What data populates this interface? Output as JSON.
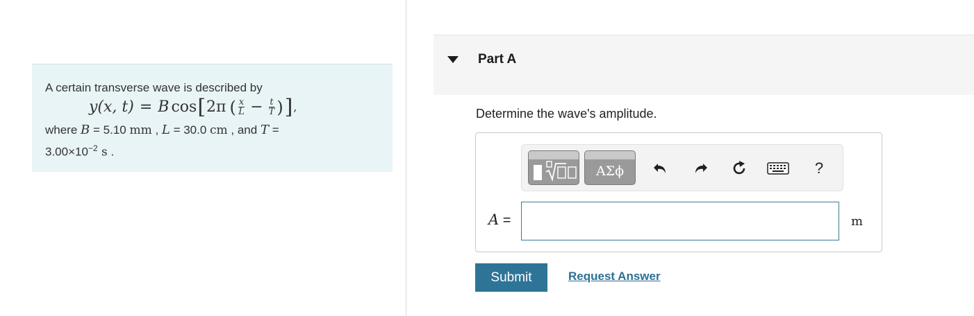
{
  "problem": {
    "intro": "A certain transverse wave is described by",
    "equation": {
      "lhs": "y(x, t)",
      "equals": "=",
      "amp": "B",
      "func": "cos",
      "two_pi": "2π",
      "frac1_num": "x",
      "frac1_den": "L",
      "minus": "−",
      "frac2_num": "t",
      "frac2_den": "T",
      "trail": ","
    },
    "where": "where",
    "B_var": "B",
    "B_eq": " = 5.10 ",
    "B_unit": "mm",
    "sep1": " , ",
    "L_var": "L",
    "L_eq": " = 30.0 ",
    "L_unit": "cm",
    "sep2": " , and ",
    "T_var": "T",
    "T_eq": " =",
    "T_mantissa": "3.00×10",
    "T_exp": "−2",
    "T_unit": " s",
    "T_end": " ."
  },
  "part": {
    "title": "Part A",
    "question": "Determine the wave's amplitude."
  },
  "toolbar": {
    "greek_label": "ΑΣϕ",
    "help_label": "?"
  },
  "answer": {
    "var": "A",
    "eq": " =",
    "value": "",
    "unit": "m"
  },
  "actions": {
    "submit": "Submit",
    "request": "Request Answer"
  },
  "colors": {
    "accent": "#2e7497",
    "problem_bg": "#e9f4f7",
    "input_border": "#3c7a96"
  }
}
